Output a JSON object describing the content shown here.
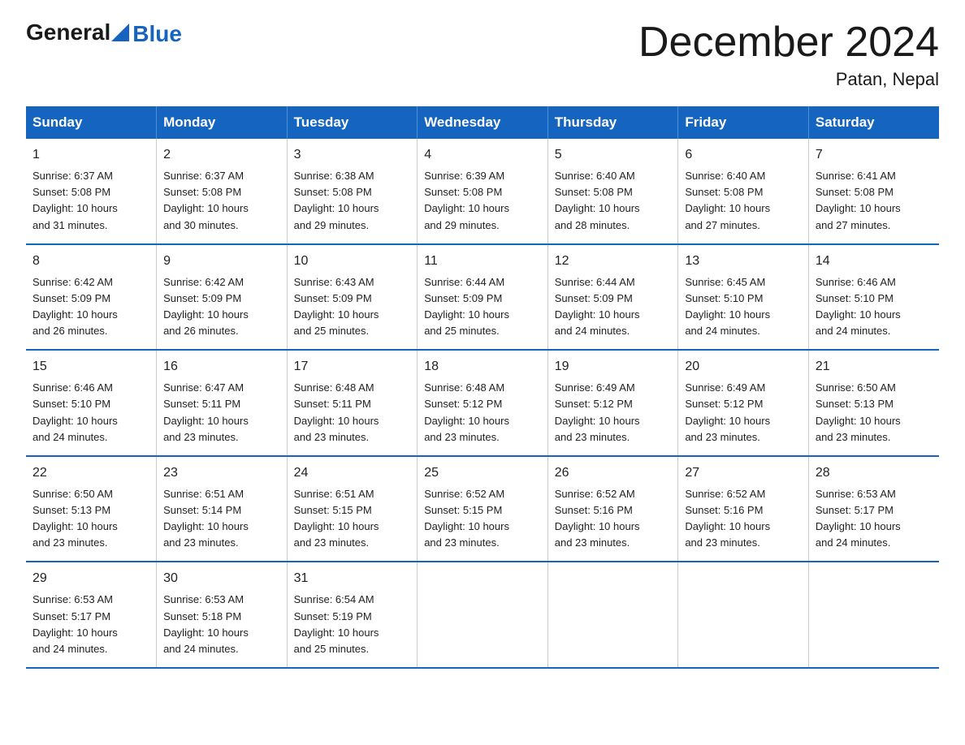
{
  "header": {
    "logo_general": "General",
    "logo_blue": "Blue",
    "month_title": "December 2024",
    "location": "Patan, Nepal"
  },
  "days_of_week": [
    "Sunday",
    "Monday",
    "Tuesday",
    "Wednesday",
    "Thursday",
    "Friday",
    "Saturday"
  ],
  "weeks": [
    [
      {
        "day": "1",
        "sunrise": "6:37 AM",
        "sunset": "5:08 PM",
        "daylight": "10 hours and 31 minutes."
      },
      {
        "day": "2",
        "sunrise": "6:37 AM",
        "sunset": "5:08 PM",
        "daylight": "10 hours and 30 minutes."
      },
      {
        "day": "3",
        "sunrise": "6:38 AM",
        "sunset": "5:08 PM",
        "daylight": "10 hours and 29 minutes."
      },
      {
        "day": "4",
        "sunrise": "6:39 AM",
        "sunset": "5:08 PM",
        "daylight": "10 hours and 29 minutes."
      },
      {
        "day": "5",
        "sunrise": "6:40 AM",
        "sunset": "5:08 PM",
        "daylight": "10 hours and 28 minutes."
      },
      {
        "day": "6",
        "sunrise": "6:40 AM",
        "sunset": "5:08 PM",
        "daylight": "10 hours and 27 minutes."
      },
      {
        "day": "7",
        "sunrise": "6:41 AM",
        "sunset": "5:08 PM",
        "daylight": "10 hours and 27 minutes."
      }
    ],
    [
      {
        "day": "8",
        "sunrise": "6:42 AM",
        "sunset": "5:09 PM",
        "daylight": "10 hours and 26 minutes."
      },
      {
        "day": "9",
        "sunrise": "6:42 AM",
        "sunset": "5:09 PM",
        "daylight": "10 hours and 26 minutes."
      },
      {
        "day": "10",
        "sunrise": "6:43 AM",
        "sunset": "5:09 PM",
        "daylight": "10 hours and 25 minutes."
      },
      {
        "day": "11",
        "sunrise": "6:44 AM",
        "sunset": "5:09 PM",
        "daylight": "10 hours and 25 minutes."
      },
      {
        "day": "12",
        "sunrise": "6:44 AM",
        "sunset": "5:09 PM",
        "daylight": "10 hours and 24 minutes."
      },
      {
        "day": "13",
        "sunrise": "6:45 AM",
        "sunset": "5:10 PM",
        "daylight": "10 hours and 24 minutes."
      },
      {
        "day": "14",
        "sunrise": "6:46 AM",
        "sunset": "5:10 PM",
        "daylight": "10 hours and 24 minutes."
      }
    ],
    [
      {
        "day": "15",
        "sunrise": "6:46 AM",
        "sunset": "5:10 PM",
        "daylight": "10 hours and 24 minutes."
      },
      {
        "day": "16",
        "sunrise": "6:47 AM",
        "sunset": "5:11 PM",
        "daylight": "10 hours and 23 minutes."
      },
      {
        "day": "17",
        "sunrise": "6:48 AM",
        "sunset": "5:11 PM",
        "daylight": "10 hours and 23 minutes."
      },
      {
        "day": "18",
        "sunrise": "6:48 AM",
        "sunset": "5:12 PM",
        "daylight": "10 hours and 23 minutes."
      },
      {
        "day": "19",
        "sunrise": "6:49 AM",
        "sunset": "5:12 PM",
        "daylight": "10 hours and 23 minutes."
      },
      {
        "day": "20",
        "sunrise": "6:49 AM",
        "sunset": "5:12 PM",
        "daylight": "10 hours and 23 minutes."
      },
      {
        "day": "21",
        "sunrise": "6:50 AM",
        "sunset": "5:13 PM",
        "daylight": "10 hours and 23 minutes."
      }
    ],
    [
      {
        "day": "22",
        "sunrise": "6:50 AM",
        "sunset": "5:13 PM",
        "daylight": "10 hours and 23 minutes."
      },
      {
        "day": "23",
        "sunrise": "6:51 AM",
        "sunset": "5:14 PM",
        "daylight": "10 hours and 23 minutes."
      },
      {
        "day": "24",
        "sunrise": "6:51 AM",
        "sunset": "5:15 PM",
        "daylight": "10 hours and 23 minutes."
      },
      {
        "day": "25",
        "sunrise": "6:52 AM",
        "sunset": "5:15 PM",
        "daylight": "10 hours and 23 minutes."
      },
      {
        "day": "26",
        "sunrise": "6:52 AM",
        "sunset": "5:16 PM",
        "daylight": "10 hours and 23 minutes."
      },
      {
        "day": "27",
        "sunrise": "6:52 AM",
        "sunset": "5:16 PM",
        "daylight": "10 hours and 23 minutes."
      },
      {
        "day": "28",
        "sunrise": "6:53 AM",
        "sunset": "5:17 PM",
        "daylight": "10 hours and 24 minutes."
      }
    ],
    [
      {
        "day": "29",
        "sunrise": "6:53 AM",
        "sunset": "5:17 PM",
        "daylight": "10 hours and 24 minutes."
      },
      {
        "day": "30",
        "sunrise": "6:53 AM",
        "sunset": "5:18 PM",
        "daylight": "10 hours and 24 minutes."
      },
      {
        "day": "31",
        "sunrise": "6:54 AM",
        "sunset": "5:19 PM",
        "daylight": "10 hours and 25 minutes."
      },
      null,
      null,
      null,
      null
    ]
  ],
  "labels": {
    "sunrise": "Sunrise:",
    "sunset": "Sunset:",
    "daylight": "Daylight:"
  }
}
